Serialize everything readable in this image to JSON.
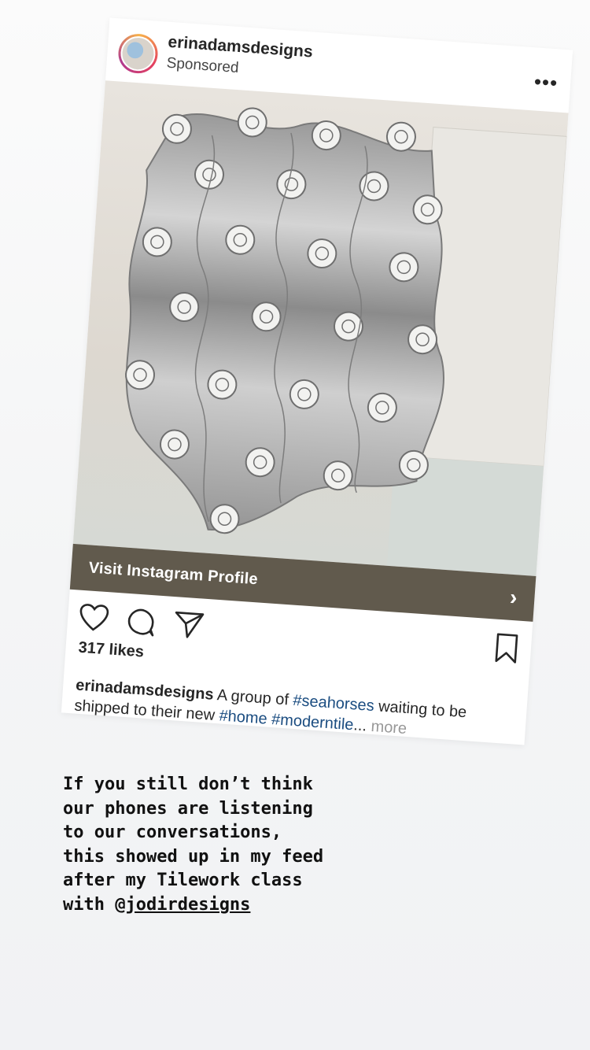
{
  "post": {
    "username": "erinadamsdesigns",
    "label": "Sponsored",
    "more_icon": "more-horizontal-icon",
    "cta": "Visit Instagram Profile",
    "likes": "317 likes",
    "caption": {
      "username": "erinadamsdesigns",
      "text_1": " A group of ",
      "tag_1": "#seahorses",
      "text_2": " waiting to be shipped to their new ",
      "tag_2": "#home",
      "text_3": " ",
      "tag_3": "#moderntile",
      "ellipsis": "...",
      "more": " more"
    },
    "icons": [
      "heart-icon",
      "comment-icon",
      "share-icon",
      "bookmark-icon"
    ],
    "colors": {
      "cta_bar": "#615a4d",
      "hashtag": "#1a4c80"
    }
  },
  "story": {
    "lines": [
      "If you still don’t think",
      "our phones are listening",
      "to our conversations,",
      "this showed up in my feed",
      "after my Tilework class"
    ],
    "last_prefix": "with @",
    "mention": "jodirdesigns"
  }
}
